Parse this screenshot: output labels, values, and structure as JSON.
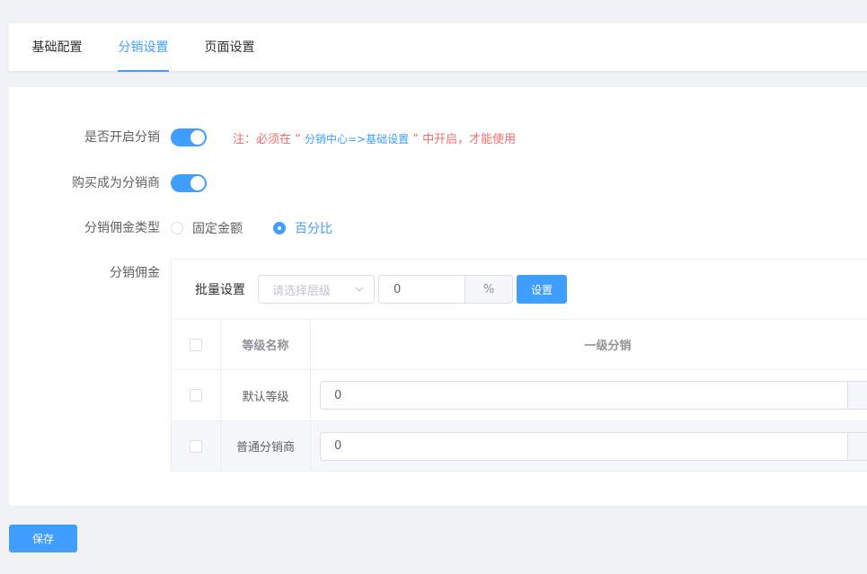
{
  "colors": {
    "primary": "#409eff",
    "danger": "#f56c6c"
  },
  "tabs": [
    {
      "label": "基础配置",
      "active": false
    },
    {
      "label": "分销设置",
      "active": true
    },
    {
      "label": "页面设置",
      "active": false
    }
  ],
  "form": {
    "enable_distribution": {
      "label": "是否开启分销",
      "on": true,
      "notice": {
        "prefix": "注：必须在 “ ",
        "link": "分销中心=>基础设置",
        "suffix": " ” 中开启，才能使用"
      }
    },
    "purchase_become_distributor": {
      "label": "购买成为分销商",
      "on": true
    },
    "commission_type": {
      "label": "分销佣金类型",
      "options": [
        {
          "label": "固定金额",
          "checked": false
        },
        {
          "label": "百分比",
          "checked": true
        }
      ]
    },
    "commission": {
      "label": "分销佣金",
      "batch": {
        "label": "批量设置",
        "level_placeholder": "请选择层级",
        "value": "0",
        "unit": "%",
        "button": "设置"
      },
      "table": {
        "headers": {
          "name": "等级名称",
          "level1": "一级分销"
        },
        "rows": [
          {
            "name": "默认等级",
            "level1": "0"
          },
          {
            "name": "普通分销商",
            "level1": "0"
          }
        ]
      }
    }
  },
  "save_label": "保存"
}
